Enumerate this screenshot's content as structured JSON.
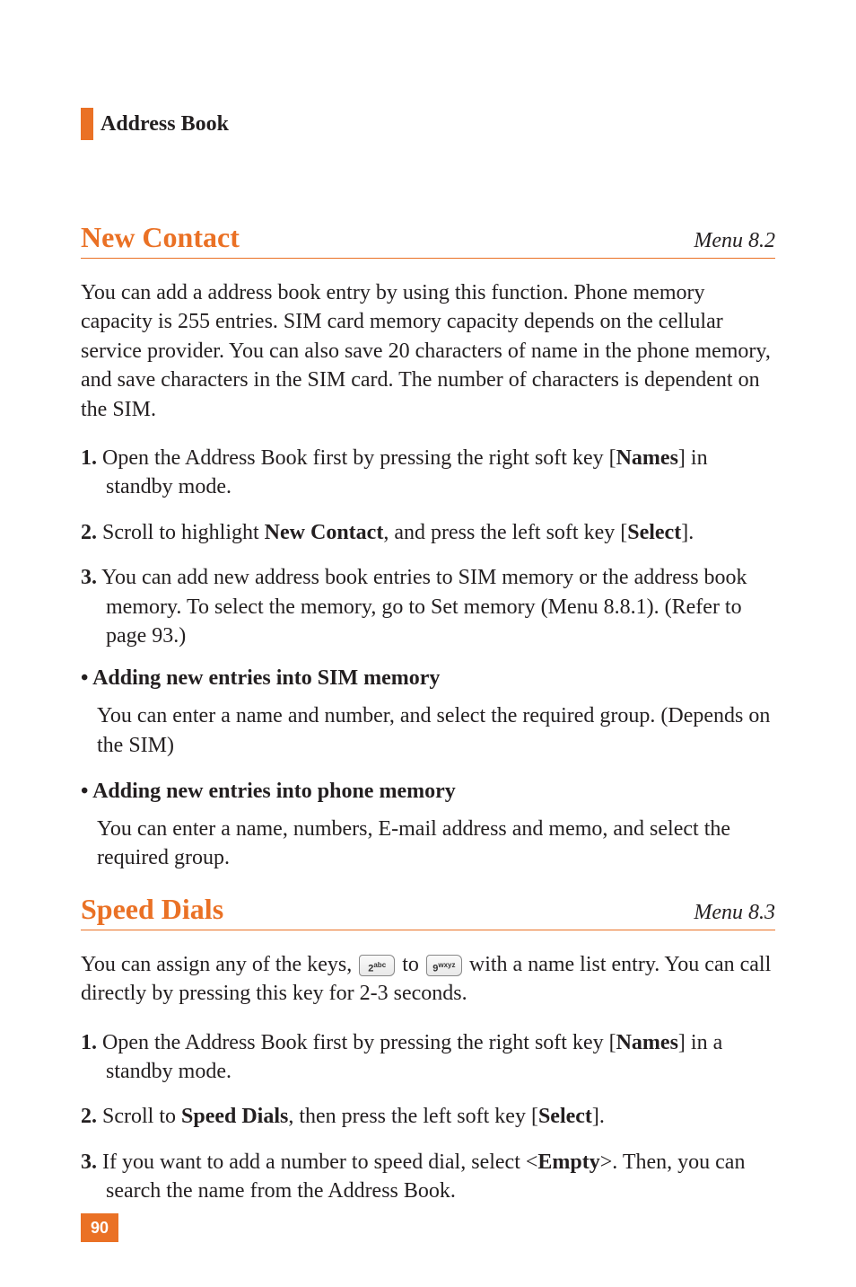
{
  "chapter": {
    "title": "Address Book"
  },
  "sections": {
    "newContact": {
      "title": "New Contact",
      "menu": "Menu 8.2",
      "intro": "You can add a address book entry by using this function. Phone memory capacity is 255 entries. SIM card memory capacity depends on the cellular service provider. You can also save 20 characters of name in the phone memory, and save characters in the SIM card. The number of characters is dependent on the SIM.",
      "step1_num": "1.",
      "step1_a": " Open the Address Book first by pressing the right soft key [",
      "step1_bold": "Names",
      "step1_b": "] in standby mode.",
      "step2_num": "2.",
      "step2_a": " Scroll to highlight ",
      "step2_bold": "New Contact",
      "step2_b": ", and press the left soft key [",
      "step2_bold2": "Select",
      "step2_c": "].",
      "step3_num": "3.",
      "step3_body": " You can add new address book entries to SIM memory or the address book memory. To select the memory, go to Set memory (Menu 8.8.1). (Refer to page 93.)",
      "simHeading": "• Adding new entries into SIM memory",
      "simBody": "You can enter a name and number, and select the required group. (Depends on the SIM)",
      "phoneHeading": "• Adding new entries into phone memory",
      "phoneBody": "You can enter a name, numbers, E-mail address and memo, and select the required group."
    },
    "speedDials": {
      "title": "Speed Dials",
      "menu": "Menu 8.3",
      "intro_a": "You can assign any of the keys, ",
      "intro_mid": " to ",
      "intro_b": " with a name list entry. You can call directly by pressing this key for 2-3 seconds.",
      "key2": "2abc",
      "key9": "9wxyz",
      "step1_num": "1.",
      "step1_a": " Open the Address Book first by pressing the right soft key [",
      "step1_bold": "Names",
      "step1_b": "] in a standby mode.",
      "step2_num": "2.",
      "step2_a": " Scroll to ",
      "step2_bold": "Speed Dials",
      "step2_b": ", then press the left soft key [",
      "step2_bold2": "Select",
      "step2_c": "].",
      "step3_num": "3.",
      "step3_a": " If you want to add a number to speed dial, select <",
      "step3_bold": "Empty",
      "step3_b": ">. Then, you can search the name from the Address Book."
    }
  },
  "pageNumber": "90"
}
